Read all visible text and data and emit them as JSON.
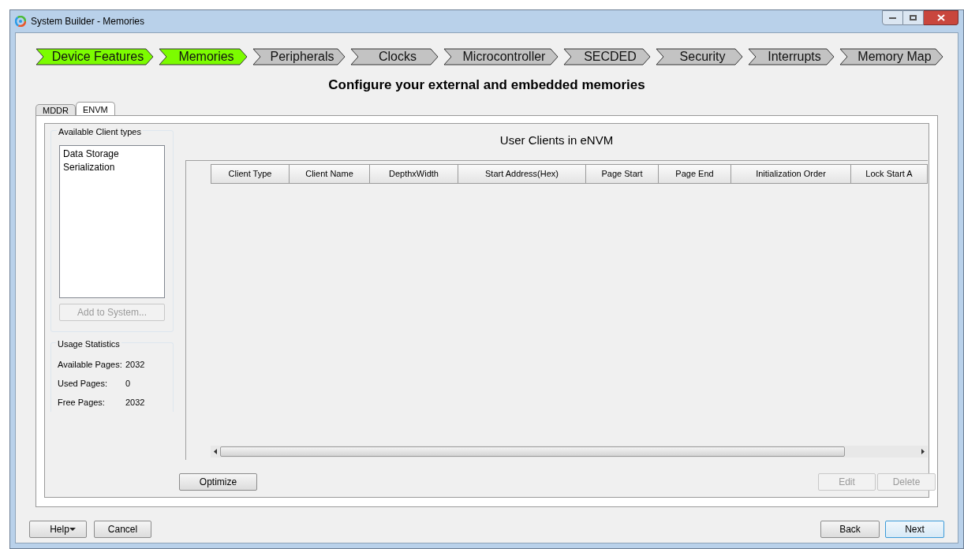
{
  "window": {
    "title": "System Builder - Memories"
  },
  "steps": [
    {
      "label": "Device Features",
      "completed": true
    },
    {
      "label": "Memories",
      "completed": true
    },
    {
      "label": "Peripherals",
      "completed": false
    },
    {
      "label": "Clocks",
      "completed": false
    },
    {
      "label": "Microcontroller",
      "completed": false
    },
    {
      "label": "SECDED",
      "completed": false
    },
    {
      "label": "Security",
      "completed": false
    },
    {
      "label": "Interrupts",
      "completed": false
    },
    {
      "label": "Memory Map",
      "completed": false
    }
  ],
  "heading": "Configure your external and embedded memories",
  "tabs": [
    {
      "label": "MDDR",
      "selected": false
    },
    {
      "label": "ENVM",
      "selected": true
    }
  ],
  "client_types": {
    "title": "Available Client types",
    "items": [
      "Data Storage",
      "Serialization"
    ],
    "add_button": {
      "label": "Add to System...",
      "disabled": true
    }
  },
  "usage_statistics": {
    "title": "Usage Statistics",
    "rows": [
      {
        "label": "Available Pages:",
        "value": "2032"
      },
      {
        "label": "Used Pages:",
        "value": "0"
      },
      {
        "label": "Free Pages:",
        "value": "2032"
      }
    ]
  },
  "clients": {
    "title": "User Clients in eNVM",
    "columns": [
      "Client Type",
      "Client Name",
      "DepthxWidth",
      "Start Address(Hex)",
      "Page Start",
      "Page End",
      "Initialization Order",
      "Lock Start A"
    ]
  },
  "actions": [
    {
      "label": "Optimize",
      "disabled": false
    },
    {
      "label": "Edit",
      "disabled": true
    },
    {
      "label": "Delete",
      "disabled": true
    }
  ],
  "footer": {
    "left": [
      {
        "label": "Help",
        "dropdown": true
      },
      {
        "label": "Cancel",
        "dropdown": false
      }
    ],
    "right": [
      {
        "label": "Back",
        "default": false
      },
      {
        "label": "Next",
        "default": true
      }
    ]
  }
}
